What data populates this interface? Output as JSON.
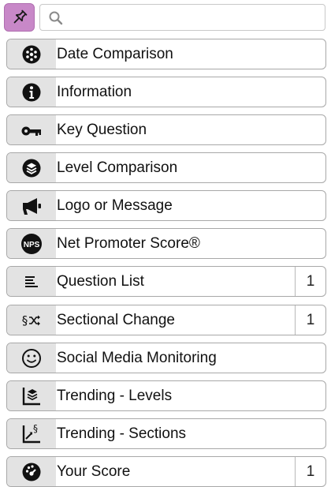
{
  "search": {
    "value": "",
    "placeholder": ""
  },
  "items": [
    {
      "label": "Date Comparison",
      "icon": "date-comparison-icon",
      "count": ""
    },
    {
      "label": "Information",
      "icon": "info-icon",
      "count": ""
    },
    {
      "label": "Key Question",
      "icon": "key-icon",
      "count": ""
    },
    {
      "label": "Level Comparison",
      "icon": "level-comparison-icon",
      "count": ""
    },
    {
      "label": "Logo or Message",
      "icon": "megaphone-icon",
      "count": ""
    },
    {
      "label": "Net Promoter Score®",
      "icon": "nps-icon",
      "count": ""
    },
    {
      "label": "Question List",
      "icon": "list-icon",
      "count": "1"
    },
    {
      "label": "Sectional Change",
      "icon": "section-shuffle-icon",
      "count": "1"
    },
    {
      "label": "Social Media Monitoring",
      "icon": "smiley-icon",
      "count": ""
    },
    {
      "label": "Trending - Levels",
      "icon": "trend-levels-icon",
      "count": ""
    },
    {
      "label": "Trending - Sections",
      "icon": "trend-sections-icon",
      "count": ""
    },
    {
      "label": "Your Score",
      "icon": "score-gauge-icon",
      "count": "1"
    }
  ],
  "nps_badge_text": "NPS",
  "section_symbol": "§",
  "colors": {
    "pin_button": "#c888c8",
    "icon_cell": "#e3e3e3",
    "border": "#a8a8a8"
  }
}
